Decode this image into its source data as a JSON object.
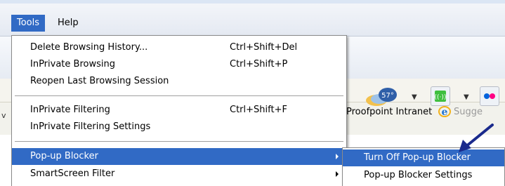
{
  "menubar": {
    "items": [
      {
        "label": "Tools",
        "active": true
      },
      {
        "label": "Help",
        "active": false
      }
    ]
  },
  "background": {
    "weather_badge": "57°",
    "favorites_text": "Proofpoint Intranet",
    "favorites_text_2": "Sugge",
    "edge_char": "v"
  },
  "tools_menu": {
    "items": [
      {
        "label": "Delete Browsing History...",
        "shortcut": "Ctrl+Shift+Del",
        "submenu": false,
        "highlighted": false
      },
      {
        "label": "InPrivate Browsing",
        "shortcut": "Ctrl+Shift+P",
        "submenu": false,
        "highlighted": false
      },
      {
        "label": "Reopen Last Browsing Session",
        "shortcut": "",
        "submenu": false,
        "highlighted": false
      },
      {
        "label": "InPrivate Filtering",
        "shortcut": "Ctrl+Shift+F",
        "submenu": false,
        "highlighted": false
      },
      {
        "label": "InPrivate Filtering Settings",
        "shortcut": "",
        "submenu": false,
        "highlighted": false
      },
      {
        "label": "Pop-up Blocker",
        "shortcut": "",
        "submenu": true,
        "highlighted": true
      },
      {
        "label": "SmartScreen Filter",
        "shortcut": "",
        "submenu": true,
        "highlighted": false
      }
    ]
  },
  "popup_submenu": {
    "items": [
      {
        "label": "Turn Off Pop-up Blocker",
        "highlighted": true
      },
      {
        "label": "Pop-up Blocker Settings",
        "highlighted": false
      }
    ]
  },
  "colors": {
    "highlight": "#316ac5",
    "annotation_arrow": "#1a2a8c"
  },
  "icons": [
    "weather-icon",
    "green-broadcast-icon",
    "flickr-icon",
    "ie-logo-icon",
    "submenu-arrow-icon",
    "annotation-arrow-icon"
  ]
}
